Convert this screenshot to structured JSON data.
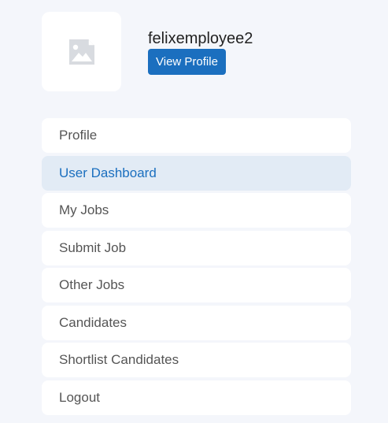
{
  "profile": {
    "avatar_icon": "image-placeholder-icon",
    "username": "felixemployee2",
    "view_profile_label": "View Profile"
  },
  "nav": {
    "active_index": 1,
    "items": [
      {
        "label": "Profile",
        "name": "nav-item-profile"
      },
      {
        "label": "User Dashboard",
        "name": "nav-item-user-dashboard"
      },
      {
        "label": "My Jobs",
        "name": "nav-item-my-jobs"
      },
      {
        "label": "Submit Job",
        "name": "nav-item-submit-job"
      },
      {
        "label": "Other Jobs",
        "name": "nav-item-other-jobs"
      },
      {
        "label": "Candidates",
        "name": "nav-item-candidates"
      },
      {
        "label": "Shortlist Candidates",
        "name": "nav-item-shortlist-candidates"
      },
      {
        "label": "Logout",
        "name": "nav-item-logout"
      }
    ]
  },
  "colors": {
    "page_background": "#f4f6fb",
    "accent": "#1b6fbf",
    "active_item_background": "#e2ebf5"
  }
}
